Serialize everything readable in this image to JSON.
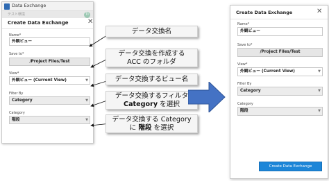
{
  "left_window": {
    "app_title": "Data Exchange",
    "subtitle": "テスト環境",
    "avatar_initials": "TI",
    "dialog_title": "Create Data Exchange",
    "name_label": "Name*",
    "name_value": "外観ビュー",
    "save_to_label": "Save to*",
    "save_to_value": "/Project Files/Test",
    "view_label": "View*",
    "view_value": "外観ビュー (Current View)",
    "filter_by_label": "Filter By",
    "filter_by_value": "Category",
    "category_label": "Category",
    "category_value": "階段"
  },
  "callouts": [
    {
      "line1": "データ交換名",
      "line2": ""
    },
    {
      "line1": "データ交換を作成する",
      "line2": "ACC のフォルダ"
    },
    {
      "line1": "データ交換するビュー名",
      "line2": ""
    },
    {
      "line1": "データ交換するフィルタ",
      "line2_bold": "Category",
      "line2_rest": " を選択"
    },
    {
      "line1": "データ交換する Category",
      "line2_pre": "に ",
      "line2_bold": "階段",
      "line2_rest": " を選択"
    }
  ],
  "right_window": {
    "dialog_title": "Create Data Exchange",
    "name_label": "Name*",
    "name_value": "外観ビュー",
    "save_to_label": "Save to*",
    "save_to_value": "/Project Files/Test",
    "view_label": "View*",
    "view_value": "外観ビュー (Current View)",
    "filter_by_label": "Filter By",
    "filter_by_value": "Category",
    "category_label": "Category",
    "category_value": "階段",
    "create_button_label": "Create Data Exchange"
  },
  "colors": {
    "accent_blue": "#1d86d8",
    "arrow_blue": "#4472c4"
  },
  "icons": {
    "app_icon": "app-icon",
    "close": "close-icon",
    "dropdown": "chevron-down-icon"
  }
}
